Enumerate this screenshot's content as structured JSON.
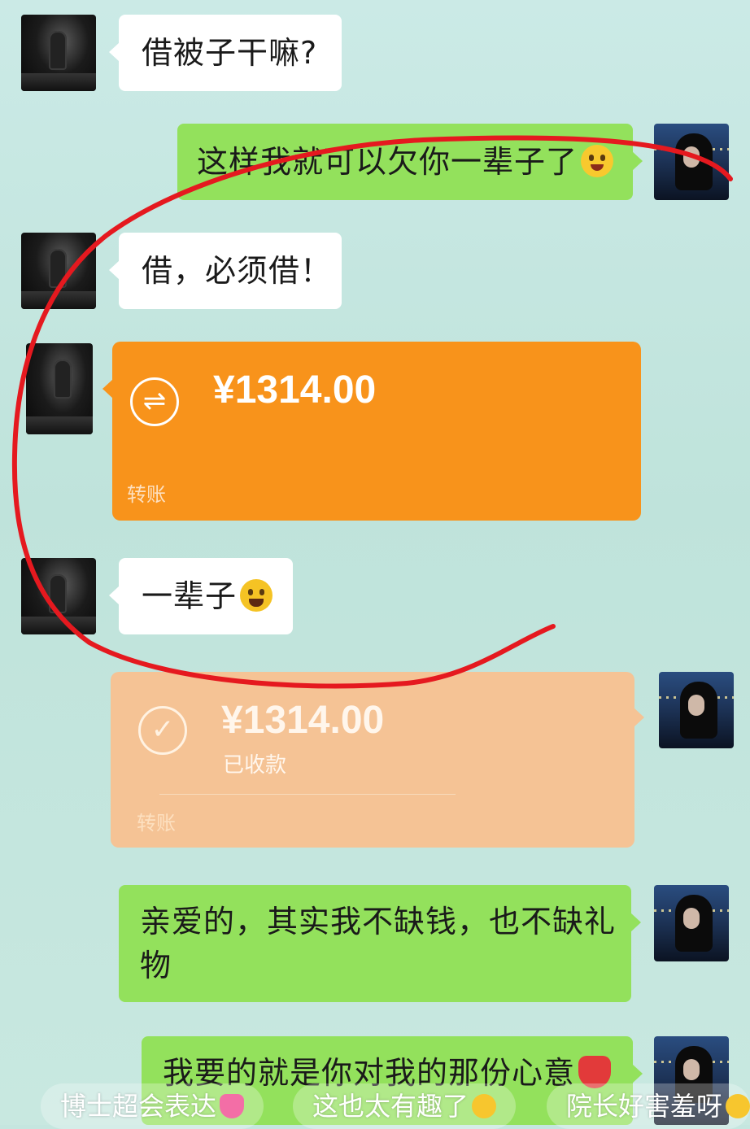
{
  "messages": [
    {
      "text": "借被子干嘛?"
    },
    {
      "text": "这样我就可以欠你一辈子了",
      "emoji": "winking-tongue-emoji"
    },
    {
      "text": "借，必须借！"
    },
    {
      "text": "一辈子",
      "emoji": "rolling-laughing-emoji"
    },
    {
      "line1": "亲爱的，其实我不缺钱，也不缺礼",
      "line2": "物"
    },
    {
      "text": "我要的就是你对我的那份心意",
      "emoji": "red-heart-emoji"
    }
  ],
  "transfers": {
    "pending": {
      "icon": "transfer-arrows-icon",
      "amount": "¥1314.00",
      "label": "转账"
    },
    "received": {
      "icon": "checkmark-icon",
      "amount": "¥1314.00",
      "status": "已收款",
      "label": "转账"
    }
  },
  "comments": [
    {
      "text": "博士超会表达",
      "emoji": "sparkling-heart-emoji"
    },
    {
      "text": "这也太有趣了",
      "emoji": "grinning-emoji"
    },
    {
      "text": "院长好害羞呀",
      "emoji": "grinning-emoji"
    }
  ],
  "colors": {
    "background": "#c5e6df",
    "incoming_bubble": "#ffffff",
    "outgoing_bubble": "#93e15c",
    "transfer_pending": "#f8931b",
    "transfer_received": "#f5c395",
    "annotation_stroke": "#e5191f"
  }
}
